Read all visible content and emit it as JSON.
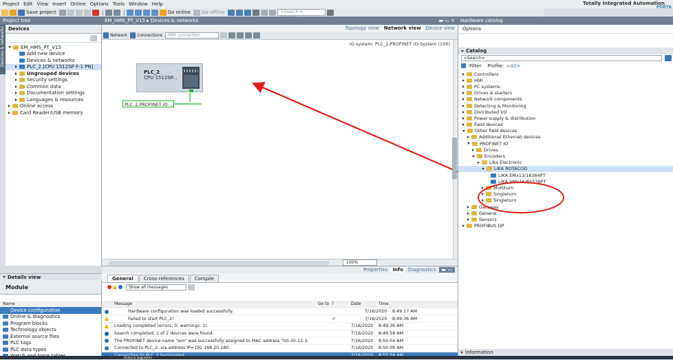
{
  "menubar": {
    "items": [
      "Project",
      "Edit",
      "View",
      "Insert",
      "Online",
      "Options",
      "Tools",
      "Window",
      "Help"
    ],
    "brand_line1": "Totally Integrated Automation",
    "brand_line2": "PORTA"
  },
  "toolbar": {
    "save_label": "Save project",
    "go_online": "Go online",
    "go_offline": "Go offline",
    "search_placeholder": "<Search in project>"
  },
  "project_tree": {
    "header": "Project tree",
    "devices_tab": "Devices",
    "side_label": "Devices & networks",
    "items": [
      {
        "label": "EM_HMS_PT_V15",
        "level": 0,
        "type": "root",
        "expand": "down"
      },
      {
        "label": "Add new device",
        "level": 1,
        "type": "add"
      },
      {
        "label": "Devices & networks",
        "level": 1,
        "type": "net"
      },
      {
        "label": "PLC_2 [CPU 1512SP F-1 PN]",
        "level": 1,
        "type": "device",
        "expand": "right",
        "selected": true
      },
      {
        "label": "Ungrouped devices",
        "level": 1,
        "type": "folder",
        "expand": "right",
        "bold": true
      },
      {
        "label": "Security settings",
        "level": 1,
        "type": "folder",
        "expand": "right"
      },
      {
        "label": "Common data",
        "level": 1,
        "type": "folder",
        "expand": "right"
      },
      {
        "label": "Documentation settings",
        "level": 1,
        "type": "folder",
        "expand": "right"
      },
      {
        "label": "Languages & resources",
        "level": 1,
        "type": "folder",
        "expand": "right"
      },
      {
        "label": "Online access",
        "level": 0,
        "type": "folder",
        "expand": "right"
      },
      {
        "label": "Card Reader/USB memory",
        "level": 0,
        "type": "folder",
        "expand": "right"
      }
    ]
  },
  "details_view": {
    "header": "Details view",
    "module_tab": "Module",
    "name_col": "Name",
    "items": [
      "Device configuration",
      "Online & diagnostics",
      "Program blocks",
      "Technology objects",
      "External source files",
      "PLC tags",
      "PLC data types",
      "Watch and force tables"
    ]
  },
  "editor": {
    "breadcrumb": "EM_HMS_PT_V15 ▸ Devices & networks",
    "views": {
      "topology": "Topology view",
      "network": "Network view",
      "device": "Device view"
    },
    "net_toolbar": {
      "network": "Network",
      "connections": "Connections",
      "conn_value": "HMI connection"
    },
    "io_system_label": "IO system: PLC_2.PROFINET IO-System (100)",
    "plc_name": "PLC_2",
    "plc_cpu": "CPU 1512SP...",
    "profinet_label": "PLC_2.PROFINET IO-...",
    "zoom": "100%"
  },
  "inspector": {
    "tabs": {
      "properties": "Properties",
      "info": "Info",
      "diagnostics": "Diagnostics"
    },
    "subtabs": [
      "General",
      "Cross-references",
      "Compile"
    ],
    "filter": "Show all messages",
    "cols": {
      "message": "Message",
      "goto": "Go to",
      "q": "?",
      "date": "Date",
      "time": "Time"
    },
    "messages": [
      {
        "icon": "ok",
        "text": "Hardware configuration was loaded successfully.",
        "goto": "",
        "date": "7/16/2020",
        "time": "8:49:17 AM",
        "indent": true
      },
      {
        "icon": "warn",
        "text": "Failed to start PLC_2!",
        "goto": "↗",
        "date": "7/16/2020",
        "time": "8:49:36 AM",
        "indent": true
      },
      {
        "icon": "warn",
        "text": "Loading completed (errors: 0; warnings: 1).",
        "goto": "",
        "date": "7/16/2020",
        "time": "8:49:36 AM",
        "indent": false
      },
      {
        "icon": "info",
        "text": "Search completed. 1 of 2 devices were found.",
        "goto": "",
        "date": "7/16/2020",
        "time": "8:49:58 AM",
        "indent": false
      },
      {
        "icon": "ok",
        "text": "The PROFINET device name \"em\" was successfully assigned to MAC address \"00-30-11-3-",
        "goto": "",
        "date": "7/16/2020",
        "time": "8:50:04 AM",
        "indent": false
      },
      {
        "icon": "ok",
        "text": "Connected to PLC_2, via address IP=192.168.20.180.",
        "goto": "",
        "date": "7/16/2020",
        "time": "8:50:09 AM",
        "indent": false
      },
      {
        "icon": "ok",
        "text": "Connection to PLC_2 terminated.",
        "goto": "",
        "date": "7/16/2020",
        "time": "8:55:54 AM",
        "indent": false,
        "selected": true
      }
    ]
  },
  "catalog": {
    "header": "Hardware catalog",
    "options": "Options",
    "title": "Catalog",
    "search_placeholder": "<Search>",
    "filter_label": "Filter",
    "profile_label": "Profile:",
    "profile_value": "<All>",
    "info_label": "Information",
    "items": [
      {
        "label": "Controllers",
        "level": 0,
        "expand": "right"
      },
      {
        "label": "HMI",
        "level": 0,
        "expand": "right"
      },
      {
        "label": "PC systems",
        "level": 0,
        "expand": "right"
      },
      {
        "label": "Drives & starters",
        "level": 0,
        "expand": "right"
      },
      {
        "label": "Network components",
        "level": 0,
        "expand": "right"
      },
      {
        "label": "Detecting & Monitoring",
        "level": 0,
        "expand": "right"
      },
      {
        "label": "Distributed I/O",
        "level": 0,
        "expand": "right"
      },
      {
        "label": "Power supply & distribution",
        "level": 0,
        "expand": "right"
      },
      {
        "label": "Field devices",
        "level": 0,
        "expand": "right"
      },
      {
        "label": "Other field devices",
        "level": 0,
        "expand": "down"
      },
      {
        "label": "Additional Ethernet devices",
        "level": 1,
        "expand": "right"
      },
      {
        "label": "PROFINET IO",
        "level": 1,
        "expand": "down"
      },
      {
        "label": "Drives",
        "level": 2,
        "expand": "right"
      },
      {
        "label": "Encoders",
        "level": 2,
        "expand": "down"
      },
      {
        "label": "Lika Electronic",
        "level": 3,
        "expand": "down"
      },
      {
        "label": "LIKA ROTACOD",
        "level": 4,
        "expand": "down",
        "selected": true
      },
      {
        "label": "LIKA EMx13/16384PT",
        "level": 5,
        "type": "device"
      },
      {
        "label": "LIKA HMx16/65536PT",
        "level": 5,
        "type": "device"
      },
      {
        "label": "Multiturn",
        "level": 4,
        "expand": "right"
      },
      {
        "label": "Singleturn",
        "level": 4,
        "expand": "right"
      },
      {
        "label": "Singleturn",
        "level": 4,
        "expand": "right"
      },
      {
        "label": "Gateway",
        "level": 1,
        "expand": "right"
      },
      {
        "label": "General",
        "level": 1,
        "expand": "right"
      },
      {
        "label": "Sensors",
        "level": 1,
        "expand": "right"
      },
      {
        "label": "PROFIBUS DP",
        "level": 0,
        "expand": "right"
      }
    ]
  },
  "taskbar": {
    "item": "Online & diagnostics"
  },
  "colors": {
    "annotation": "#e01e1e",
    "profinet": "#1fb33a",
    "header": "#6c8092",
    "selection": "#3c7bbd"
  }
}
